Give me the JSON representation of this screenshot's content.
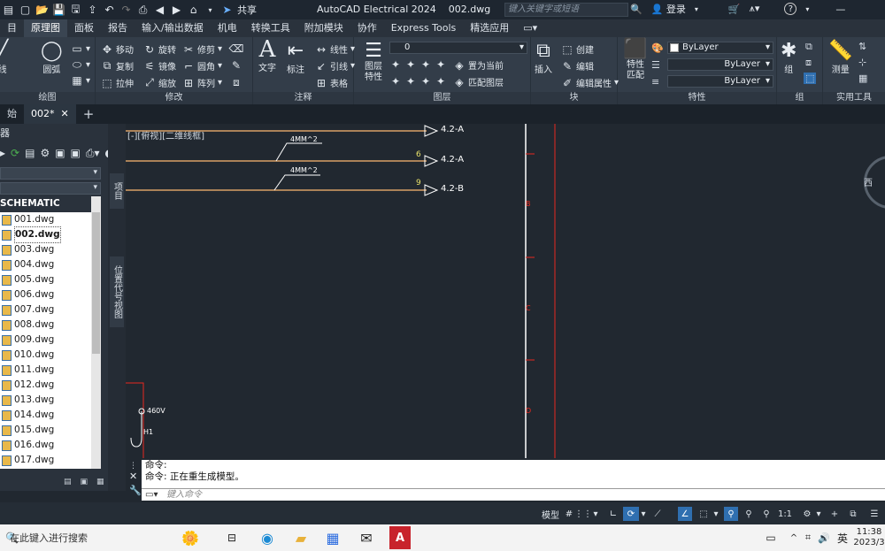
{
  "title_bar": {
    "app_title": "AutoCAD Electrical 2024",
    "doc_name": "002.dwg",
    "search_placeholder": "键入关键字或短语",
    "login_label": "登录",
    "share_label": "共享"
  },
  "ribbon_tabs": [
    "目",
    "原理图",
    "面板",
    "报告",
    "输入/输出数据",
    "机电",
    "转换工具",
    "附加模块",
    "协作",
    "Express Tools",
    "精选应用"
  ],
  "ribbon": {
    "draw": {
      "label": "绘图",
      "line": "线",
      "circle": "圆弧"
    },
    "modify": {
      "label": "修改",
      "buttons": [
        "移动",
        "旋转",
        "修剪",
        "复制",
        "镜像",
        "圆角",
        "拉伸",
        "缩放",
        "阵列"
      ]
    },
    "annotation": {
      "label": "注释",
      "text": "文字",
      "dim": "标注",
      "linear": "线性",
      "leader": "引线",
      "table": "表格"
    },
    "layers": {
      "label": "图层",
      "layer_props": "图层特性",
      "layer_value": "0",
      "set_current": "置为当前",
      "match_layer": "匹配图层"
    },
    "block": {
      "label": "块",
      "insert": "插入",
      "create": "创建",
      "edit": "编辑",
      "edit_attr": "编辑属性"
    },
    "properties": {
      "label": "特性",
      "match": "特性匹配",
      "color": "ByLayer",
      "linetype": "ByLayer",
      "lineweight": "ByLayer"
    },
    "groups": {
      "label": "组",
      "group": "组"
    },
    "utilities": {
      "label": "实用工具",
      "measure": "测量"
    }
  },
  "doc_tabs": [
    "始",
    "002*"
  ],
  "left_panel": {
    "title": "器",
    "vertical_tabs": [
      "项目",
      "位置代号视图"
    ],
    "project_name": "SCHEMATIC",
    "files": [
      "001.dwg",
      "002.dwg",
      "003.dwg",
      "004.dwg",
      "005.dwg",
      "006.dwg",
      "007.dwg",
      "008.dwg",
      "009.dwg",
      "010.dwg",
      "011.dwg",
      "012.dwg",
      "013.dwg",
      "014.dwg",
      "015.dwg",
      "016.dwg",
      "017.dwg"
    ],
    "selected_file": "002.dwg"
  },
  "drawing": {
    "viewport_label": "[-][俯视][二维线框]",
    "wires": [
      {
        "wire_no": "",
        "size": "",
        "ref": "4.2-A"
      },
      {
        "wire_no": "6",
        "size": "4MM^2",
        "ref": "4.2-A"
      },
      {
        "wire_no": "9",
        "size": "4MM^2",
        "ref": "4.2-B"
      }
    ],
    "border_zones": [
      "B",
      "C",
      "D"
    ],
    "voltage_label": "460V",
    "terminal_label": "H1",
    "viewcube_label": "西"
  },
  "command": {
    "history": [
      "命令:",
      "命令: 正在重生成模型。"
    ],
    "input_placeholder": "键入命令"
  },
  "status_bar": {
    "model_label": "模型",
    "scale": "1:1"
  },
  "taskbar": {
    "search_placeholder": "在此键入进行搜索",
    "ime": "英",
    "time": "11:38",
    "date": "2023/3"
  },
  "colors": {
    "wire_orange": "#d9a066",
    "border_red": "#e8281f",
    "cad_bg": "#212830"
  }
}
